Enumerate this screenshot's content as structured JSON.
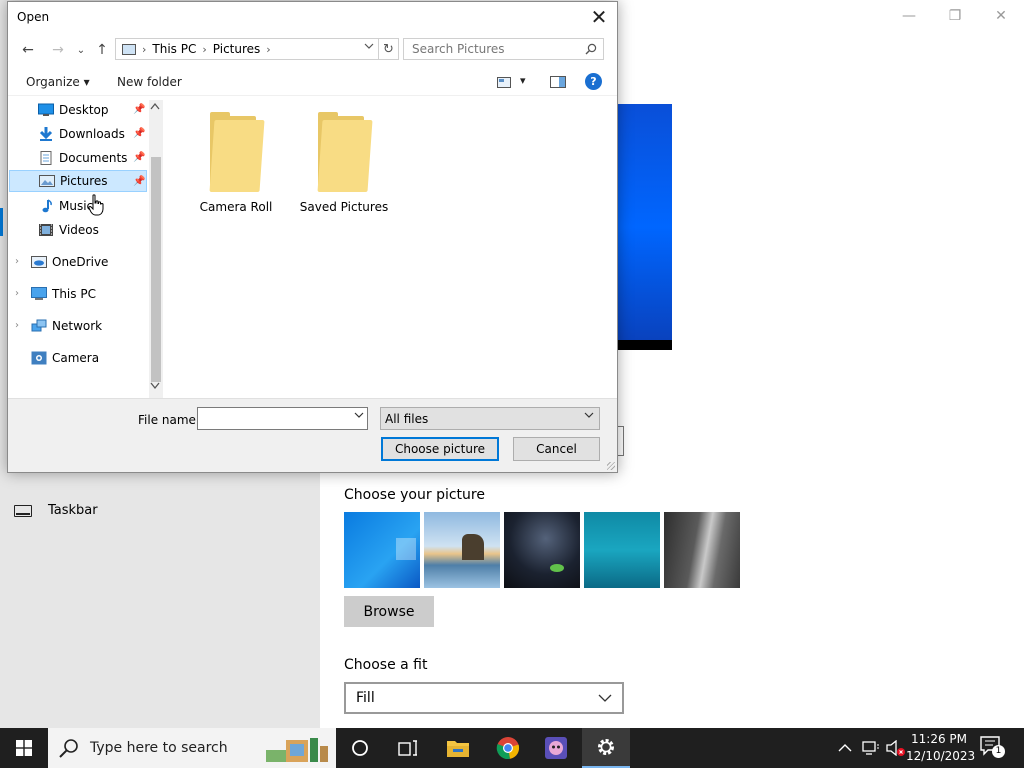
{
  "settings": {
    "side": {
      "taskbar_label": "Taskbar"
    },
    "window_controls": {
      "minimize": "—",
      "restore": "❐",
      "close": "✕"
    },
    "choose_picture_label": "Choose your picture",
    "browse_label": "Browse",
    "choose_fit_label": "Choose a fit",
    "fit_value": "Fill"
  },
  "dialog": {
    "title": "Open",
    "close_glyph": "✕",
    "nav": {
      "back": "←",
      "forward": "→",
      "recent": "⌄",
      "up": "↑"
    },
    "address": {
      "crumbs": [
        "This PC",
        "Pictures"
      ],
      "separator": "›"
    },
    "refresh_glyph": "↻",
    "search_placeholder": "Search Pictures",
    "toolbar": {
      "organize": "Organize ▾",
      "new_folder": "New folder",
      "view_drop": "▾",
      "help": "?"
    },
    "nav_items": [
      {
        "label": "Desktop",
        "icon": "desktop-icon"
      },
      {
        "label": "Downloads",
        "icon": "downloads-icon"
      },
      {
        "label": "Documents",
        "icon": "documents-icon"
      },
      {
        "label": "Pictures",
        "icon": "pictures-icon",
        "selected": true
      },
      {
        "label": "Music",
        "icon": "music-icon"
      },
      {
        "label": "Videos",
        "icon": "videos-icon"
      },
      {
        "label": "OneDrive",
        "icon": "onedrive-icon"
      },
      {
        "label": "This PC",
        "icon": "this-pc-icon"
      },
      {
        "label": "Network",
        "icon": "network-icon"
      },
      {
        "label": "Camera",
        "icon": "camera-icon"
      }
    ],
    "pin_glyph": "📌",
    "expand_glyph": "›",
    "folders": [
      "Camera Roll",
      "Saved Pictures"
    ],
    "file_name_label": "File name:",
    "file_name_value": "",
    "file_type": "All files",
    "choose_button": "Choose picture",
    "cancel_button": "Cancel"
  },
  "taskbar": {
    "search_placeholder": "Type here to search",
    "clock_time": "11:26 PM",
    "clock_date": "12/10/2023",
    "notification_count": "1"
  },
  "colors": {
    "accent": "#0078d7",
    "selection": "#cce8ff",
    "folder": "#f8dc84"
  }
}
